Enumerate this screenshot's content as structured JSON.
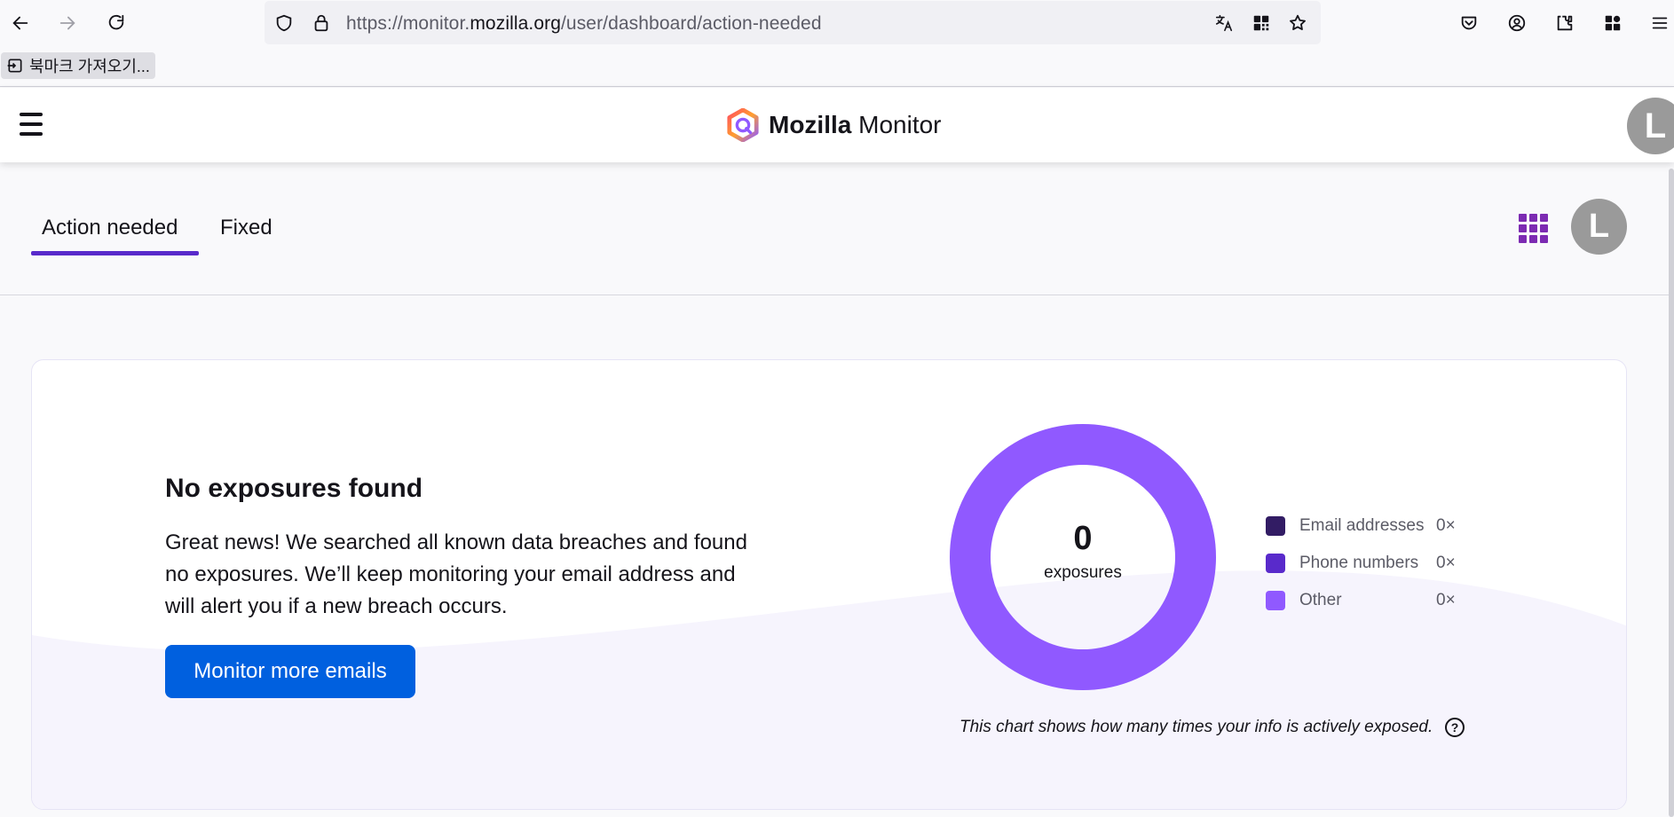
{
  "browser": {
    "url_prefix": "https://monitor.",
    "url_host": "mozilla.org",
    "url_path": "/user/dashboard/action-needed",
    "bookmark_label": "북마크 가져오기..."
  },
  "header": {
    "brand_bold": "Mozilla",
    "brand_light": " Monitor",
    "avatar_initial": "L"
  },
  "tabs": {
    "action_needed": "Action needed",
    "fixed": "Fixed",
    "avatar_initial": "L"
  },
  "card": {
    "title": "No exposures found",
    "body": "Great news! We searched all known data breaches and found no exposures. We’ll keep monitoring your email address and will alert you if a new breach occurs.",
    "button_label": "Monitor more emails",
    "chart_caption": "This chart shows how many times your info is actively exposed.",
    "help_symbol": "?"
  },
  "chart_data": {
    "type": "pie",
    "center_value": "0",
    "center_label": "exposures",
    "series": [
      {
        "name": "Email addresses",
        "value": 0,
        "display": "0×",
        "color": "#321c64"
      },
      {
        "name": "Phone numbers",
        "value": 0,
        "display": "0×",
        "color": "#592acb"
      },
      {
        "name": "Other",
        "value": 0,
        "display": "0×",
        "color": "#9059ff"
      }
    ],
    "empty_ring_color": "#9059ff",
    "legend_position": "right"
  },
  "colors": {
    "accent": "#592acb",
    "button": "#0060df",
    "donut": "#9059ff"
  }
}
